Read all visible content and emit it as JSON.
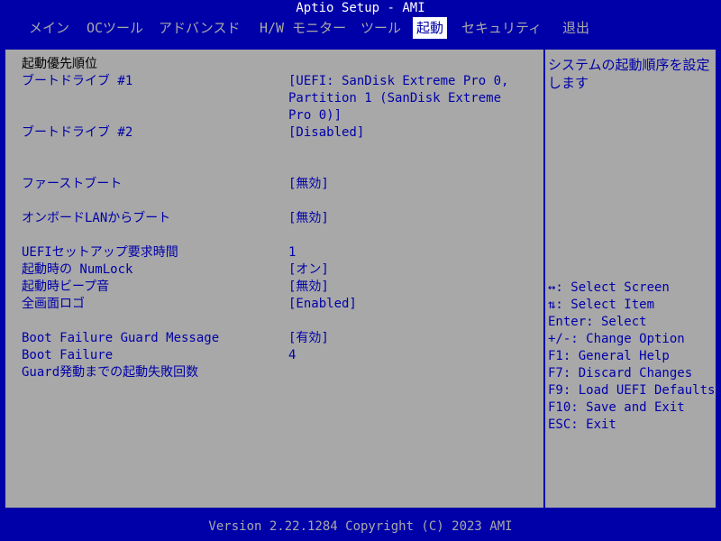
{
  "title": "Aptio Setup - AMI",
  "menu": [
    "メイン",
    "OCツール",
    "アドバンスド",
    "H/W モニター",
    "ツール",
    "起動",
    "セキュリティ",
    "退出"
  ],
  "active_menu": "起動",
  "main": {
    "section_header": "起動優先順位",
    "boot_option_1": {
      "label": "ブートドライブ #1",
      "value_lines": [
        "[UEFI: SanDisk Extreme Pro 0,",
        "Partition 1 (SanDisk Extreme",
        "Pro 0)]"
      ]
    },
    "boot_option_2": {
      "label": "ブートドライブ #2",
      "value": "[Disabled]"
    },
    "fast_boot": {
      "label": "ファーストブート",
      "value": "[無効]"
    },
    "onboard_lan_boot": {
      "label": "オンボードLANからブート",
      "value": "[無効]"
    },
    "uefi_setup_prompt": {
      "label": "UEFIセットアップ要求時間",
      "value": "1"
    },
    "boot_numlock": {
      "label": "起動時の NumLock",
      "value": "[オン]"
    },
    "boot_beep": {
      "label": "起動時ビープ音",
      "value": "[無効]"
    },
    "full_screen_logo": {
      "label": "全画面ロゴ",
      "value": "[Enabled]"
    },
    "boot_failure_guard_message": {
      "label": "Boot Failure Guard Message",
      "value": "[有効]"
    },
    "boot_failure_guard_count": {
      "label_lines": [
        "Boot Failure",
        "Guard発動までの起動失敗回数"
      ],
      "value": "4"
    }
  },
  "help": {
    "description": "システムの起動順序を設定します",
    "keys": [
      "↔: Select Screen",
      "⇅: Select Item",
      "Enter: Select",
      "+/-: Change Option",
      "F1: General Help",
      "F7: Discard Changes",
      "F9: Load UEFI Defaults",
      "F10: Save and Exit",
      "ESC: Exit"
    ]
  },
  "footer": "Version 2.22.1284 Copyright (C) 2023 AMI",
  "colors": {
    "background": "#0000a8",
    "panel": "#a8a8a8",
    "text": "#0000a8",
    "header_text": "#000000",
    "title_text": "#ffffff"
  }
}
